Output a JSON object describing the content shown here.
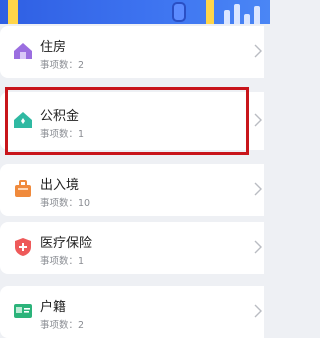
{
  "items": [
    {
      "title": "住房",
      "count_label": "事项数：2",
      "icon": "house-icon",
      "color": "#9b6ee0"
    },
    {
      "title": "公积金",
      "count_label": "事项数：1",
      "icon": "house-fund-icon",
      "color": "#2fb9a2"
    },
    {
      "title": "出入境",
      "count_label": "事项数：10",
      "icon": "luggage-icon",
      "color": "#f08a3c"
    },
    {
      "title": "医疗保险",
      "count_label": "事项数：1",
      "icon": "medical-shield-icon",
      "color": "#ee5a5a"
    },
    {
      "title": "户籍",
      "count_label": "事项数：2",
      "icon": "household-register-icon",
      "color": "#2bb37a"
    }
  ],
  "highlight_color": "#c8151b",
  "banner_color": "#3d73f0"
}
